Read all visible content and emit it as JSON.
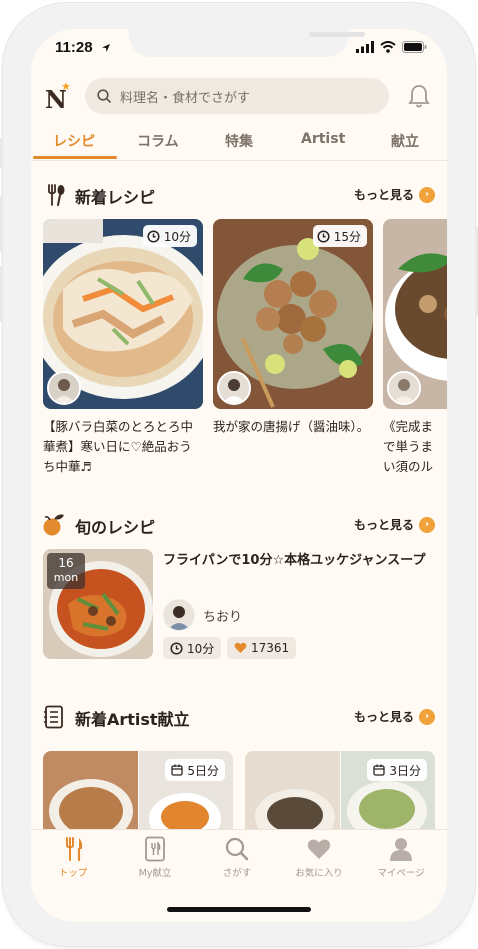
{
  "status": {
    "time": "11:28"
  },
  "header": {
    "logo": "N",
    "search_placeholder": "料理名・食材でさがす"
  },
  "tabs": [
    "レシピ",
    "コラム",
    "特集",
    "Artist",
    "献立"
  ],
  "sections": {
    "new_recipes": {
      "title": "新着レシピ",
      "more": "もっと見る"
    },
    "seasonal": {
      "title": "旬のレシピ",
      "more": "もっと見る"
    },
    "artist_menus": {
      "title": "新着Artist献立",
      "more": "もっと見る"
    }
  },
  "new_recipes": [
    {
      "time": "10分",
      "title": "【豚バラ白菜のとろとろ中華煮】寒い日に♡絶品おうち中華♬"
    },
    {
      "time": "15分",
      "title": "我が家の唐揚げ（醤油味）。"
    },
    {
      "time": "",
      "title": "《完成まで単うまい須のルー"
    }
  ],
  "seasonal_recipe": {
    "day": "16",
    "weekday": "mon",
    "title": "フライパンで10分☆本格ユッケジャンスープ",
    "author": "ちおり",
    "time": "10分",
    "likes": "17361"
  },
  "artist_menus": [
    {
      "days": "5日分"
    },
    {
      "days": "3日分"
    }
  ],
  "bottom_nav": [
    {
      "label": "トップ",
      "icon": "fork-knife-icon"
    },
    {
      "label": "My献立",
      "icon": "menu-book-icon"
    },
    {
      "label": "さがす",
      "icon": "search-icon"
    },
    {
      "label": "お気に入り",
      "icon": "heart-icon"
    },
    {
      "label": "マイページ",
      "icon": "person-icon"
    }
  ],
  "colors": {
    "accent": "#e38a2e",
    "background": "#fffaf3",
    "search_bg": "#efe9e1"
  }
}
